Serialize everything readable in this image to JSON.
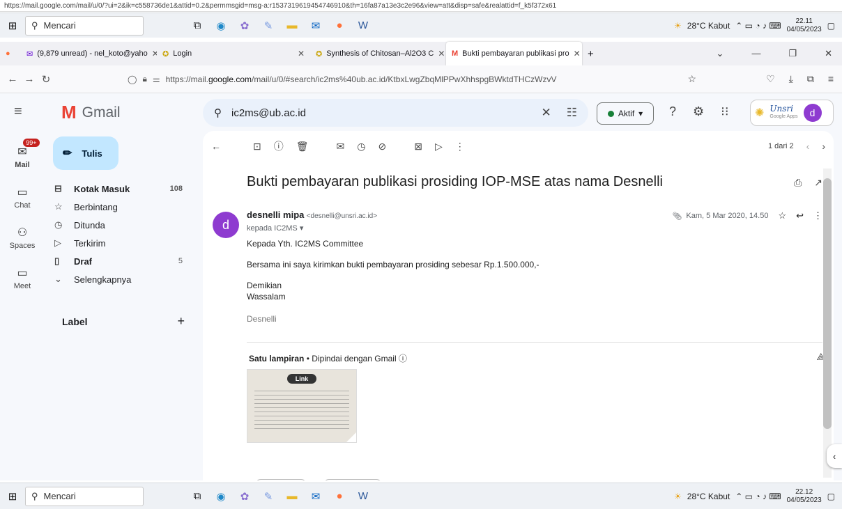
{
  "url_strip": "https://mail.google.com/mail/u/0/?ui=2&ik=c558736de1&attid=0.2&permmsgid=msg-a:r1537319619454746910&th=16fa87a13e3c2e96&view=att&disp=safe&realattid=f_k5f372x61",
  "taskbar_top": {
    "search": "Mencari",
    "weather": "28°C Kabut",
    "time": "22.11",
    "date": "04/05/2023"
  },
  "taskbar_bottom": {
    "search": "Mencari",
    "weather": "28°C Kabut",
    "time": "22.12",
    "date": "04/05/2023"
  },
  "tabs": [
    {
      "label": "(9,879 unread) - nel_koto@yaho",
      "active": false
    },
    {
      "label": "Login",
      "active": false
    },
    {
      "label": "Synthesis of Chitosan–Al2O3 C",
      "active": false
    },
    {
      "label": "Bukti pembayaran publikasi pro",
      "active": true
    }
  ],
  "address": {
    "prefix": "https://mail.",
    "domain": "google.com",
    "rest": "/mail/u/0/#search/ic2ms%40ub.ac.id/KtbxLwgZbqMlPPwXhhspgBWktdTHCzWzvV"
  },
  "gmail": {
    "logo_text": "Gmail",
    "search_value": "ic2ms@ub.ac.id",
    "status_label": "Aktif",
    "apps_brand": "Unsri",
    "apps_sub": "Google Apps",
    "avatar_letter": "d"
  },
  "rail": [
    {
      "label": "Mail",
      "badge": "99+"
    },
    {
      "label": "Chat"
    },
    {
      "label": "Spaces"
    },
    {
      "label": "Meet"
    }
  ],
  "compose_label": "Tulis",
  "nav": [
    {
      "label": "Kotak Masuk",
      "count": "108",
      "bold": true
    },
    {
      "label": "Berbintang",
      "count": ""
    },
    {
      "label": "Ditunda",
      "count": ""
    },
    {
      "label": "Terkirim",
      "count": ""
    },
    {
      "label": "Draf",
      "count": "5",
      "bold": true
    },
    {
      "label": "Selengkapnya",
      "count": ""
    }
  ],
  "label_header": "Label",
  "pager": "1 dari 2",
  "email": {
    "subject": "Bukti pembayaran publikasi prosiding IOP-MSE atas nama Desnelli",
    "sender_name": "desnelli mipa",
    "sender_email": "<desnelli@unsri.ac.id>",
    "to": "kepada IC2MS",
    "date": "Kam, 5 Mar 2020, 14.50",
    "greeting": "Kepada Yth. IC2MS Committee",
    "line1": "Bersama ini saya kirimkan bukti pembayaran prosiding sebesar Rp.1.500.000,-",
    "closing1": "Demikian",
    "closing2": "Wassalam",
    "signature": "Desnelli",
    "attach_title": "Satu lampiran",
    "attach_note": "Dipindai dengan Gmail",
    "thumb_logo": "Link"
  }
}
